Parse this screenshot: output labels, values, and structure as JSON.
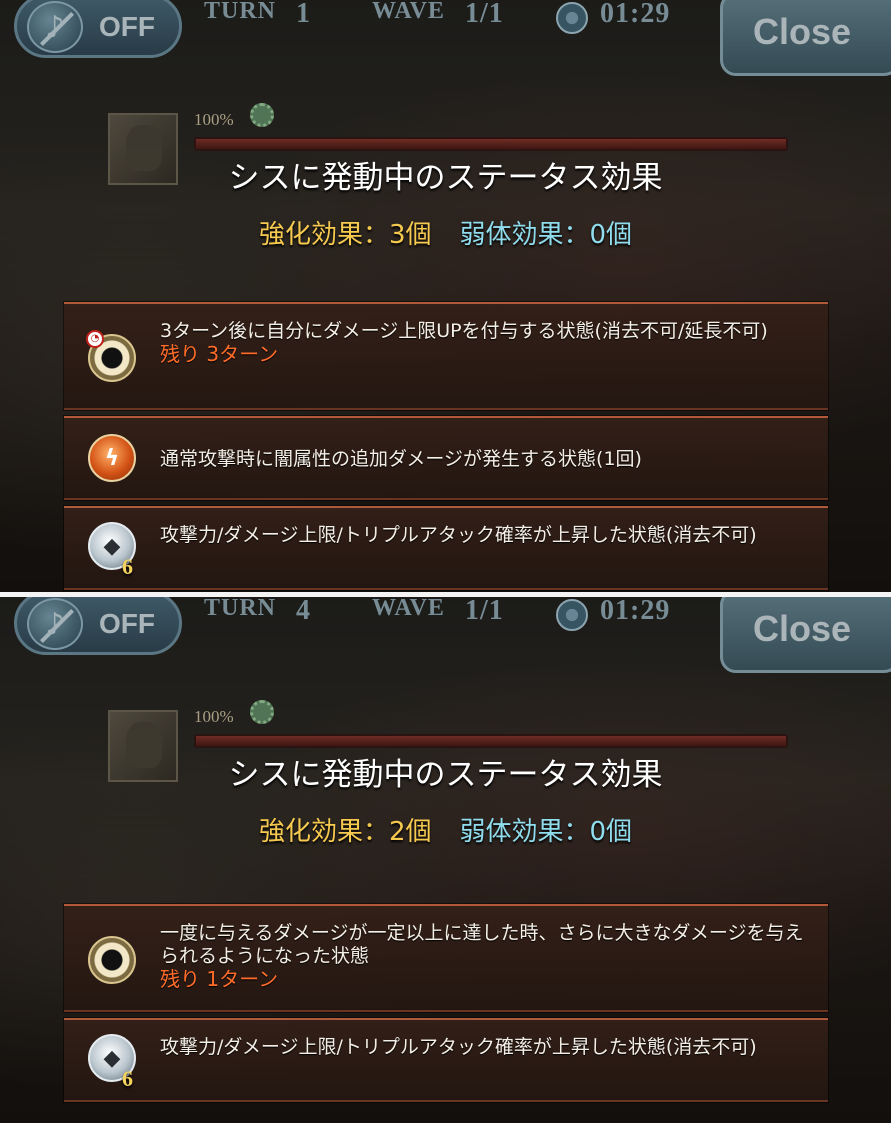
{
  "panel_a": {
    "sound_label": "OFF",
    "turn_label": "TURN",
    "turn_value": "1",
    "wave_label": "WAVE",
    "wave_value": "1/1",
    "timer": "01:29",
    "close_label": "Close",
    "hp_percent": "100%",
    "title": "シスに発動中のステータス効果",
    "buff_count": "強化効果：3個",
    "debuff_count": "弱体効果：0個",
    "statuses": [
      {
        "icon": "damage-cap-ring-icon",
        "text": "3ターン後に自分にダメージ上限UPを付与する状態(消去不可/延長不可)",
        "remaining": "残り 3ターン"
      },
      {
        "icon": "dark-bonus-damage-icon",
        "text": "通常攻撃時に闇属性の追加ダメージが発生する状態(1回)"
      },
      {
        "icon": "wolf-icon",
        "stack": "6",
        "text": "攻撃力/ダメージ上限/トリプルアタック確率が上昇した状態(消去不可)"
      }
    ]
  },
  "panel_b": {
    "sound_label": "OFF",
    "turn_label": "TURN",
    "turn_value": "4",
    "wave_label": "WAVE",
    "wave_value": "1/1",
    "timer": "01:29",
    "close_label": "Close",
    "hp_percent": "100%",
    "title": "シスに発動中のステータス効果",
    "buff_count": "強化効果：2個",
    "debuff_count": "弱体効果：0個",
    "statuses": [
      {
        "icon": "damage-cap-ring-icon",
        "text": "一度に与えるダメージが一定以上に達した時、さらに大きなダメージを与えられるようになった状態",
        "remaining": "残り 1ターン"
      },
      {
        "icon": "wolf-icon",
        "stack": "6",
        "text": "攻撃力/ダメージ上限/トリプルアタック確率が上昇した状態(消去不可)"
      }
    ]
  },
  "colors": {
    "buff": "#f6c94f",
    "debuff": "#8fdced",
    "remaining": "#ff6c2a",
    "row_border": "#b05a3a"
  }
}
